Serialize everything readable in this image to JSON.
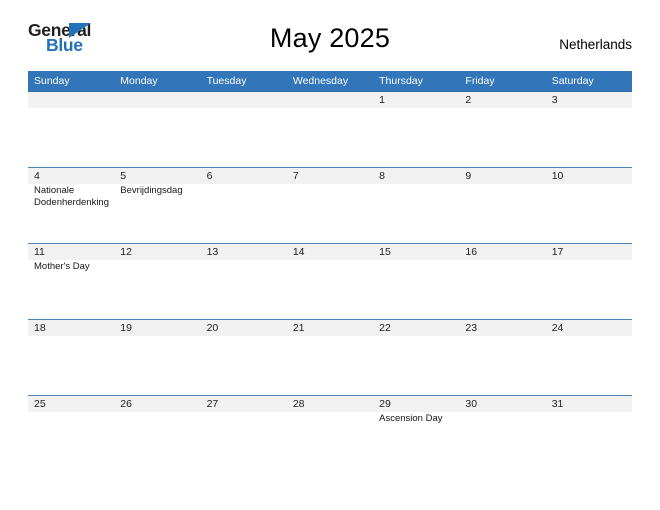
{
  "brand": {
    "name_part1": "General",
    "name_part2": "Blue",
    "accent_color": "#2372b9",
    "dark_color": "#231f20"
  },
  "header": {
    "title": "May 2025",
    "country": "Netherlands"
  },
  "theme": {
    "header_row_color": "#3275b8",
    "row_rule_color": "#4a86bd",
    "daynum_band_color": "#f1f1f1",
    "page_background": "#ffffff"
  },
  "calendar": {
    "month": "May",
    "year": "2025",
    "weekday_headers": [
      "Sunday",
      "Monday",
      "Tuesday",
      "Wednesday",
      "Thursday",
      "Friday",
      "Saturday"
    ],
    "weeks": [
      [
        {
          "day": "",
          "events": []
        },
        {
          "day": "",
          "events": []
        },
        {
          "day": "",
          "events": []
        },
        {
          "day": "",
          "events": []
        },
        {
          "day": "1",
          "events": []
        },
        {
          "day": "2",
          "events": []
        },
        {
          "day": "3",
          "events": []
        }
      ],
      [
        {
          "day": "4",
          "events": [
            "Nationale Dodenherdenking"
          ]
        },
        {
          "day": "5",
          "events": [
            "Bevrijdingsdag"
          ]
        },
        {
          "day": "6",
          "events": []
        },
        {
          "day": "7",
          "events": []
        },
        {
          "day": "8",
          "events": []
        },
        {
          "day": "9",
          "events": []
        },
        {
          "day": "10",
          "events": []
        }
      ],
      [
        {
          "day": "11",
          "events": [
            "Mother's Day"
          ]
        },
        {
          "day": "12",
          "events": []
        },
        {
          "day": "13",
          "events": []
        },
        {
          "day": "14",
          "events": []
        },
        {
          "day": "15",
          "events": []
        },
        {
          "day": "16",
          "events": []
        },
        {
          "day": "17",
          "events": []
        }
      ],
      [
        {
          "day": "18",
          "events": []
        },
        {
          "day": "19",
          "events": []
        },
        {
          "day": "20",
          "events": []
        },
        {
          "day": "21",
          "events": []
        },
        {
          "day": "22",
          "events": []
        },
        {
          "day": "23",
          "events": []
        },
        {
          "day": "24",
          "events": []
        }
      ],
      [
        {
          "day": "25",
          "events": []
        },
        {
          "day": "26",
          "events": []
        },
        {
          "day": "27",
          "events": []
        },
        {
          "day": "28",
          "events": []
        },
        {
          "day": "29",
          "events": [
            "Ascension Day"
          ]
        },
        {
          "day": "30",
          "events": []
        },
        {
          "day": "31",
          "events": []
        }
      ]
    ]
  }
}
